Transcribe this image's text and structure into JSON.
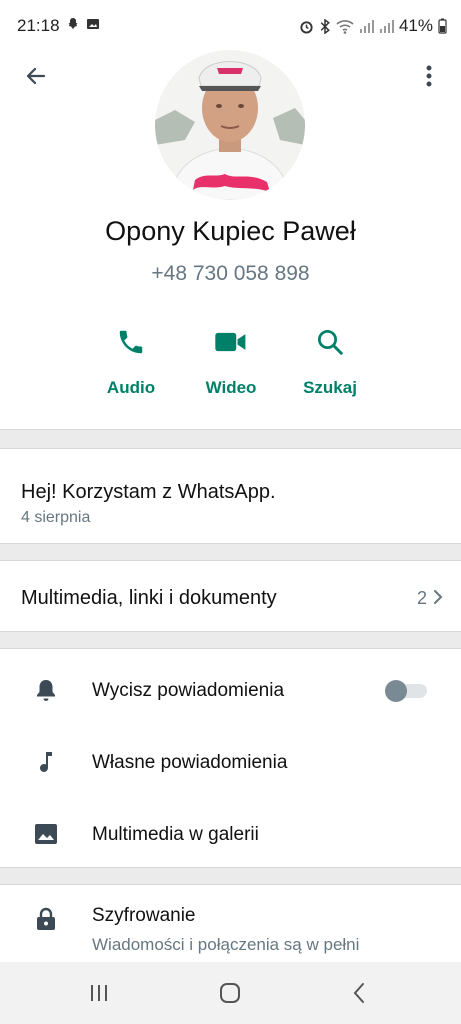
{
  "status_bar": {
    "time": "21:18",
    "battery": "41%"
  },
  "header": {
    "back_icon": "arrow-left-icon",
    "menu_icon": "more-vertical-icon"
  },
  "contact": {
    "name": "Opony Kupiec Paweł",
    "phone": "+48 730 058 898"
  },
  "actions": [
    {
      "label": "Audio",
      "icon": "phone-icon"
    },
    {
      "label": "Wideo",
      "icon": "video-icon"
    },
    {
      "label": "Szukaj",
      "icon": "search-icon"
    }
  ],
  "about": {
    "text": "Hej! Korzystam z WhatsApp.",
    "date": "4 sierpnia"
  },
  "media": {
    "label": "Multimedia, linki i dokumenty",
    "count": "2"
  },
  "settings": [
    {
      "label": "Wycisz powiadomienia",
      "icon": "bell-icon",
      "toggle_on": false
    },
    {
      "label": "Własne powiadomienia",
      "icon": "music-note-icon"
    },
    {
      "label": "Multimedia w galerii",
      "icon": "image-icon"
    }
  ],
  "encryption": {
    "title": "Szyfrowanie",
    "subtitle": "Wiadomości i połączenia są w pełni zaszyfrowane. Kliknij, aby"
  },
  "colors": {
    "accent": "#008069",
    "secondary_text": "#667781"
  }
}
